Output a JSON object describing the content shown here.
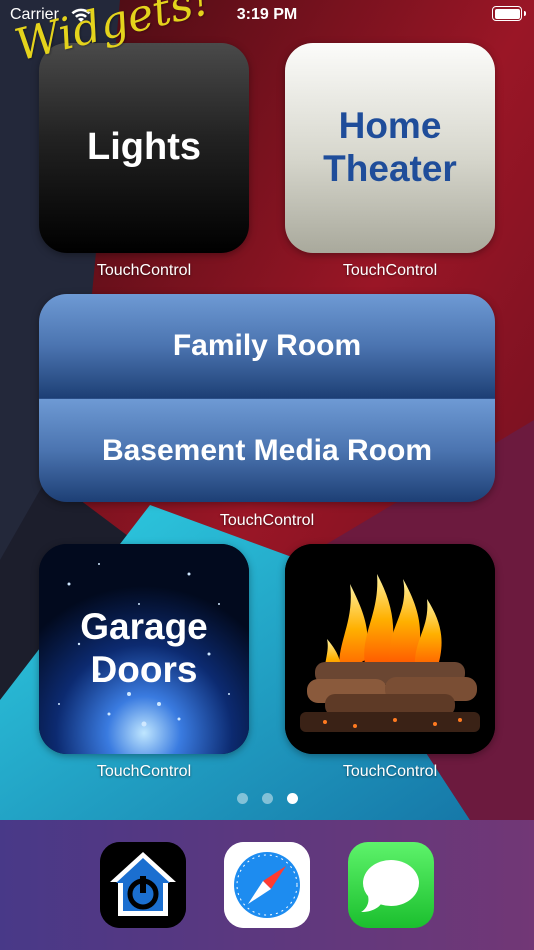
{
  "status_bar": {
    "carrier": "Carrier",
    "time": "3:19 PM"
  },
  "overlay_caption": "Widgets!",
  "widgets": {
    "lights": {
      "title": "Lights",
      "label": "TouchControl"
    },
    "home_theater": {
      "title_line1": "Home",
      "title_line2": "Theater",
      "label": "TouchControl"
    },
    "rooms": {
      "buttons": [
        "Family Room",
        "Basement Media Room"
      ],
      "label": "TouchControl"
    },
    "garage": {
      "title_line1": "Garage",
      "title_line2": "Doors",
      "label": "TouchControl"
    },
    "fireplace": {
      "label": "TouchControl"
    }
  },
  "page_dots": {
    "count": 3,
    "active_index": 2
  },
  "dock": {
    "apps": [
      {
        "name": "touchcontrol",
        "icon": "house-power-icon"
      },
      {
        "name": "safari",
        "icon": "compass-icon"
      },
      {
        "name": "messages",
        "icon": "speech-bubble-icon"
      }
    ]
  },
  "colors": {
    "home_theater_text": "#1f4d9a",
    "widgets_caption": "#e4d31c",
    "room_button_blue": "#4b74b0"
  }
}
